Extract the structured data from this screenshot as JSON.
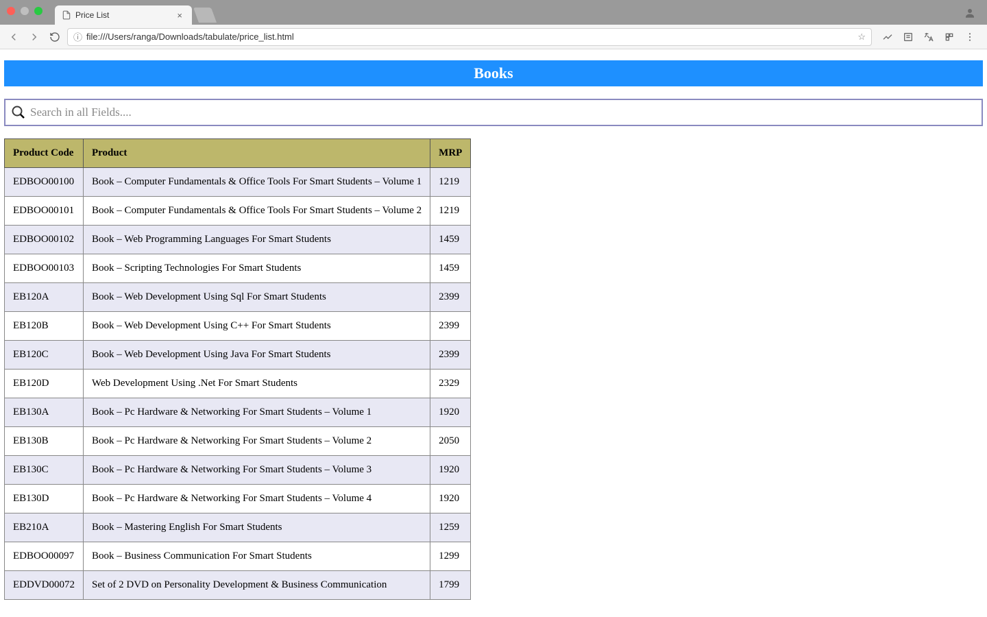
{
  "browser": {
    "tab_title": "Price List",
    "url": "file:///Users/ranga/Downloads/tabulate/price_list.html"
  },
  "page": {
    "title": "Books",
    "search_placeholder": "Search in all Fields....",
    "table": {
      "columns": [
        "Product Code",
        "Product",
        "MRP"
      ],
      "rows": [
        {
          "code": "EDBOO00100",
          "product": "Book – Computer Fundamentals & Office Tools For Smart Students – Volume 1",
          "mrp": "1219"
        },
        {
          "code": "EDBOO00101",
          "product": "Book – Computer Fundamentals & Office Tools For Smart Students – Volume 2",
          "mrp": "1219"
        },
        {
          "code": "EDBOO00102",
          "product": "Book – Web Programming Languages For Smart Students",
          "mrp": "1459"
        },
        {
          "code": "EDBOO00103",
          "product": "Book – Scripting Technologies For Smart Students",
          "mrp": "1459"
        },
        {
          "code": "EB120A",
          "product": "Book – Web Development Using Sql For Smart Students",
          "mrp": "2399"
        },
        {
          "code": "EB120B",
          "product": "Book – Web Development Using C++ For Smart Students",
          "mrp": "2399"
        },
        {
          "code": "EB120C",
          "product": "Book – Web Development Using Java For Smart Students",
          "mrp": "2399"
        },
        {
          "code": "EB120D",
          "product": "Web Development Using .Net For Smart Students",
          "mrp": "2329"
        },
        {
          "code": "EB130A",
          "product": "Book – Pc Hardware & Networking For Smart Students – Volume 1",
          "mrp": "1920"
        },
        {
          "code": "EB130B",
          "product": "Book – Pc Hardware & Networking For Smart Students – Volume 2",
          "mrp": "2050"
        },
        {
          "code": "EB130C",
          "product": "Book – Pc Hardware & Networking For Smart Students – Volume 3",
          "mrp": "1920"
        },
        {
          "code": "EB130D",
          "product": "Book – Pc Hardware & Networking For Smart Students – Volume 4",
          "mrp": "1920"
        },
        {
          "code": "EB210A",
          "product": "Book – Mastering English For Smart Students",
          "mrp": "1259"
        },
        {
          "code": "EDBOO00097",
          "product": "Book – Business Communication For Smart Students",
          "mrp": "1299"
        },
        {
          "code": "EDDVD00072",
          "product": "Set of 2 DVD on Personality Development & Business Communication",
          "mrp": "1799"
        }
      ]
    }
  }
}
